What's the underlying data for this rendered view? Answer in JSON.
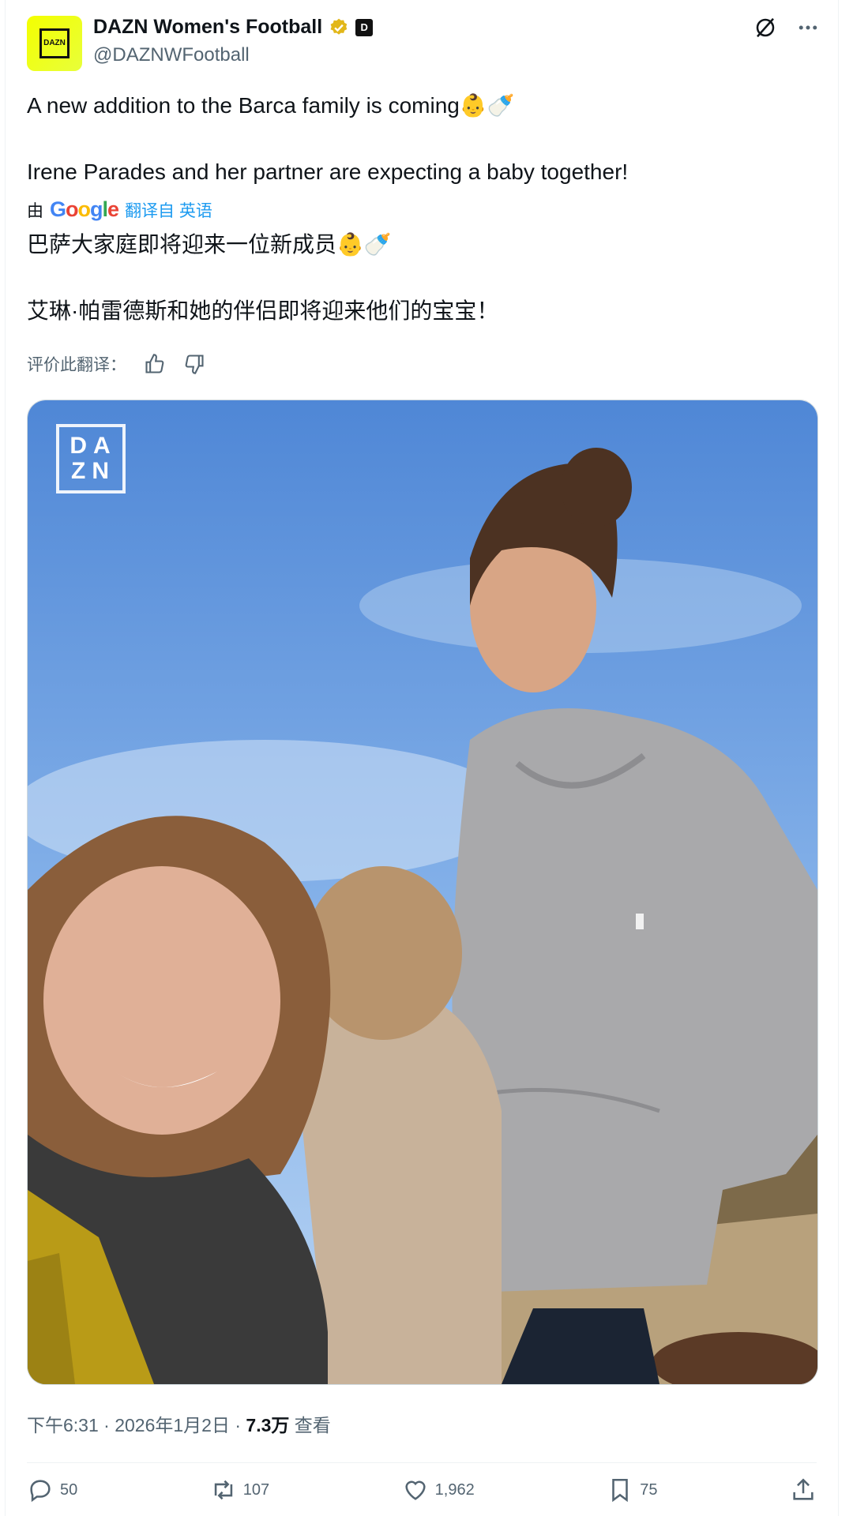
{
  "account": {
    "display_name": "DAZN Women's Football",
    "handle": "@DAZNWFootball",
    "avatar_text": "DAZN",
    "affiliate_badge": "D"
  },
  "tweet": {
    "line1": "A new addition to the Barca family is coming👶🍼",
    "line2": "Irene Parades and her partner are expecting a baby together!"
  },
  "translation": {
    "by": "由",
    "google": "Google",
    "translated_from": "翻译自 英语",
    "line1": "巴萨大家庭即将迎来一位新成员👶🍼",
    "line2": "艾琳·帕雷德斯和她的伴侣即将迎来他们的宝宝！",
    "rate_label": "评价此翻译："
  },
  "media": {
    "watermark_top": "DA",
    "watermark_bottom": "ZN"
  },
  "meta": {
    "time_date": "下午6:31 · 2026年1月2日 · ",
    "views_count": "7.3万",
    "views_label": " 查看"
  },
  "actions": {
    "replies": "50",
    "reposts": "107",
    "likes": "1,962",
    "bookmarks": "75"
  },
  "colors": {
    "accent": "#1d9bf0",
    "verified": "#e2b719",
    "brand_yellow": "#f4ff00"
  }
}
